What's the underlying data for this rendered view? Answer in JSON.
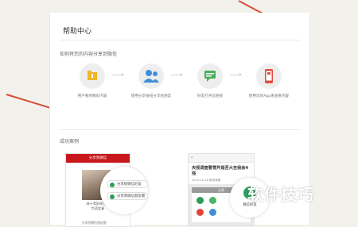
{
  "page": {
    "title": "帮助中心",
    "section_howto": "如何将您的内容分享到微信",
    "section_cases": "成功案例"
  },
  "steps": [
    {
      "icon": "folder-icon",
      "label": "用户看到精彩内容"
    },
    {
      "icon": "users-icon",
      "label": "使用分享按钮分享给朋友"
    },
    {
      "icon": "chat-icon",
      "label": "好友打开此链接"
    },
    {
      "icon": "phone-icon",
      "label": "使用您的App来查看内容"
    }
  ],
  "case1": {
    "header": "分享到微信",
    "name_line1": "林十鸢别样写真",
    "name_line2": "华语女星",
    "bottom_text": "分享到微信朋友圈",
    "popup_items": [
      "分享给微信好友",
      "分享到微信朋友圈"
    ]
  },
  "case2": {
    "headline": "央视调查曹雪芹是否大吉我会4强",
    "meta": "2013-10-28 新浪观察",
    "share_header": "分享",
    "popup_label": "微信好友"
  },
  "watermark": "软件技巧",
  "colors": {
    "accent_red": "#c8181b",
    "wechat_green": "#2d9c55",
    "arrow_red": "#d54f3c"
  }
}
